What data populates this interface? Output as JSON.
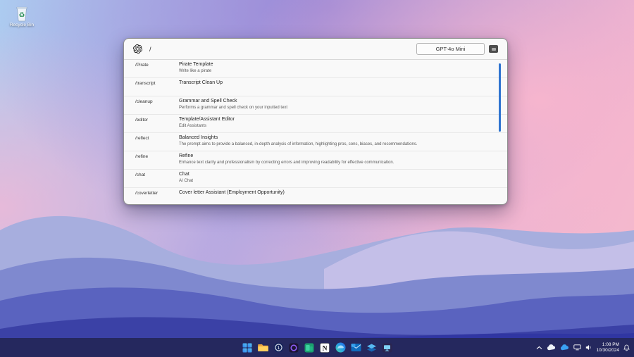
{
  "desktop": {
    "recycle_bin_label": "Recycle Bin"
  },
  "window": {
    "prompt": "/",
    "model_selector": {
      "value": "GPT-4o Mini"
    },
    "commands": [
      {
        "command": "/Pirate",
        "title": "Pirate Template",
        "description": "Write like a pirate"
      },
      {
        "command": "/transcript",
        "title": "Transcript Clean Up",
        "description": ""
      },
      {
        "command": "/cleanup",
        "title": "Grammar and Spell Check",
        "description": "Performs a grammar and spell check on your inputted text"
      },
      {
        "command": "/editor",
        "title": "Template/Assistant Editor",
        "description": "Edit Assistants"
      },
      {
        "command": "/reflect",
        "title": "Balanced Insights",
        "description": "The prompt aims to provide a balanced, in-depth analysis of information, highlighting pros, cons, biases, and recommendations."
      },
      {
        "command": "/refine",
        "title": "Refine",
        "description": "Enhance text clarity and professionalism by correcting errors and improving readability for effective communication."
      },
      {
        "command": "/chat",
        "title": "Chat",
        "description": "AI Chat"
      },
      {
        "command": "/coverletter",
        "title": "Cover letter Assistant (Employment Opportunity)",
        "description": ""
      }
    ]
  },
  "taskbar": {
    "icons": [
      "start",
      "file-explorer",
      "onepassword",
      "purple-ring-app",
      "green-app",
      "notion",
      "edge",
      "outlook",
      "mail-layers",
      "monitor-app"
    ],
    "tray": {
      "time": "1:08 PM",
      "date": "10/30/2024",
      "icons": [
        "hidden-icons-chevron",
        "cloud-white",
        "cloud-blue",
        "network",
        "speaker",
        "bell"
      ]
    }
  },
  "colors": {
    "taskbar_bg": "#25285e",
    "scrollbar": "#2f74d0",
    "window_bg": "#f9f9f9",
    "accent_blue": "#3aa0f3"
  }
}
